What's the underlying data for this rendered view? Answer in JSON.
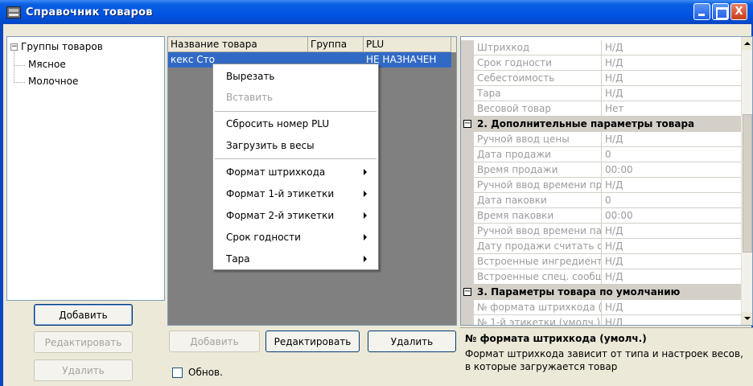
{
  "window": {
    "title": "Справочник товаров",
    "minimize": "",
    "maximize": "",
    "close": "X"
  },
  "tree": {
    "root": "Группы товаров",
    "root_toggle": "−",
    "children": [
      "Мясное",
      "Молочное"
    ]
  },
  "left_buttons": {
    "add": "Добавить",
    "edit": "Редактировать",
    "delete": "Удалить"
  },
  "grid": {
    "columns": [
      "Название товара",
      "Группа",
      "PLU"
    ],
    "rows": [
      {
        "name": "кекс Сто",
        "group": "",
        "plu": "НЕ НАЗНАЧЕН"
      }
    ]
  },
  "context_menu": {
    "items": [
      {
        "label": "Вырезать",
        "enabled": true,
        "submenu": false
      },
      {
        "label": "Вставить",
        "enabled": false,
        "submenu": false
      },
      {
        "label": "Сбросить номер PLU",
        "enabled": true,
        "submenu": false
      },
      {
        "label": "Загрузить в весы",
        "enabled": true,
        "submenu": false
      },
      {
        "label": "Формат штрихкода",
        "enabled": true,
        "submenu": true
      },
      {
        "label": "Формат 1-й этикетки",
        "enabled": true,
        "submenu": true
      },
      {
        "label": "Формат 2-й этикетки",
        "enabled": true,
        "submenu": true
      },
      {
        "label": "Срок годности",
        "enabled": true,
        "submenu": true
      },
      {
        "label": "Тара",
        "enabled": true,
        "submenu": true
      }
    ]
  },
  "grid_buttons": {
    "add": "Добавить",
    "edit": "Редактировать",
    "delete": "Удалить"
  },
  "refresh_checkbox": {
    "label": "Обнов.",
    "checked": false
  },
  "properties": {
    "rows_top": [
      {
        "name": "Штрихкод",
        "value": "Н/Д"
      },
      {
        "name": "Срок годности",
        "value": "Н/Д"
      },
      {
        "name": "Себестоимость",
        "value": "Н/Д"
      },
      {
        "name": "Тара",
        "value": "Н/Д"
      },
      {
        "name": "Весовой товар",
        "value": "Нет"
      }
    ],
    "section2": {
      "title": "2. Дополнительные параметры товара",
      "toggle": "−",
      "rows": [
        {
          "name": "Ручной ввод цены",
          "value": "Н/Д"
        },
        {
          "name": "Дата продажи",
          "value": "0"
        },
        {
          "name": "Время продажи",
          "value": "00:00"
        },
        {
          "name": "Ручной ввод времени про",
          "value": "Н/Д"
        },
        {
          "name": "Дата паковки",
          "value": "0"
        },
        {
          "name": "Время паковки",
          "value": "00:00"
        },
        {
          "name": "Ручной ввод времени пак",
          "value": "Н/Д"
        },
        {
          "name": "Дату продажи считать от",
          "value": "Н/Д"
        },
        {
          "name": "Встроенные ингредиенты",
          "value": "Н/Д"
        },
        {
          "name": "Встроенные спец. сообщ",
          "value": "Н/Д"
        }
      ]
    },
    "section3": {
      "title": "3. Параметры товара по умолчанию",
      "toggle": "−",
      "rows": [
        {
          "name": "№ формата штрихкода (у",
          "value": "Н/Д"
        },
        {
          "name": "№ 1-й этикетки (умолч.)",
          "value": "Н/Д"
        }
      ]
    }
  },
  "help": {
    "title": "№ формата штрихкода (умолч.)",
    "text": "Формат штрихкода зависит от типа и настроек весов, в которые загружается товар"
  },
  "colors": {
    "titlebar": "#0054e3",
    "selection": "#316ac5",
    "grid_background": "#808080",
    "window_face": "#ece9d8"
  }
}
